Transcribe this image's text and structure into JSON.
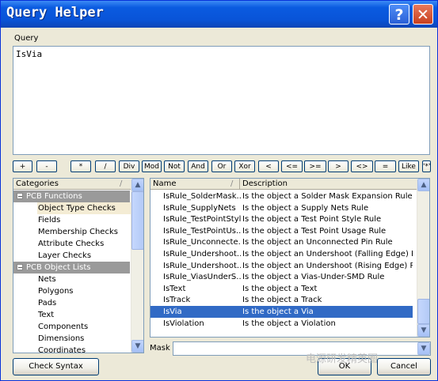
{
  "window": {
    "title": "Query Helper",
    "help_glyph": "?",
    "close_glyph": "✕"
  },
  "query": {
    "label": "Query",
    "value": "IsVia"
  },
  "operators": [
    "+",
    "-",
    "*",
    "/",
    "Div",
    "Mod",
    "Not",
    "And",
    "Or",
    "Xor",
    "<",
    "<=",
    ">=",
    ">",
    "<>",
    "=",
    "Like",
    "'*'"
  ],
  "categories": {
    "header": "Categories",
    "sort_glyph": "/",
    "items": [
      {
        "label": "PCB Functions",
        "type": "group",
        "expander": "−"
      },
      {
        "label": "Object Type Checks",
        "type": "selected"
      },
      {
        "label": "Fields",
        "type": "item"
      },
      {
        "label": "Membership Checks",
        "type": "item"
      },
      {
        "label": "Attribute Checks",
        "type": "item"
      },
      {
        "label": "Layer Checks",
        "type": "item"
      },
      {
        "label": "PCB Object Lists",
        "type": "group",
        "expander": "−"
      },
      {
        "label": "Nets",
        "type": "item"
      },
      {
        "label": "Polygons",
        "type": "item"
      },
      {
        "label": "Pads",
        "type": "item"
      },
      {
        "label": "Text",
        "type": "item"
      },
      {
        "label": "Components",
        "type": "item"
      },
      {
        "label": "Dimensions",
        "type": "item"
      },
      {
        "label": "Coordinates",
        "type": "item"
      }
    ]
  },
  "functions": {
    "columns": {
      "name": "Name",
      "description": "Description",
      "sort_glyph": "/"
    },
    "rows": [
      {
        "name": "IsRule_SolderMask...",
        "description": "Is the object a Solder Mask Expansion Rule"
      },
      {
        "name": "IsRule_SupplyNets",
        "description": "Is the object a Supply Nets Rule"
      },
      {
        "name": "IsRule_TestPointStyle",
        "description": "Is the object a Test Point Style Rule"
      },
      {
        "name": "IsRule_TestPointUs...",
        "description": "Is the object a Test Point Usage Rule"
      },
      {
        "name": "IsRule_Unconnecte...",
        "description": "Is the object an Unconnected Pin Rule"
      },
      {
        "name": "IsRule_Undershoot...",
        "description": "Is the object an Undershoot (Falling Edge) Rule"
      },
      {
        "name": "IsRule_Undershoot...",
        "description": "Is the object an Undershoot (Rising Edge) Rule"
      },
      {
        "name": "IsRule_ViasUnderS...",
        "description": "Is the object a Vias-Under-SMD Rule"
      },
      {
        "name": "IsText",
        "description": "Is the object a Text"
      },
      {
        "name": "IsTrack",
        "description": "Is the object a Track"
      },
      {
        "name": "IsVia",
        "description": "Is the object a Via",
        "selected": true
      },
      {
        "name": "IsViolation",
        "description": "Is the object a Violation"
      }
    ]
  },
  "mask": {
    "label": "Mask",
    "value": ""
  },
  "buttons": {
    "check_syntax": "Check Syntax",
    "ok": "OK",
    "cancel": "Cancel"
  },
  "watermark": "电源研发精英圈",
  "colors": {
    "title_bar": "#0a5be0",
    "selection": "#316ac5",
    "group_header": "#9a9a9a"
  }
}
